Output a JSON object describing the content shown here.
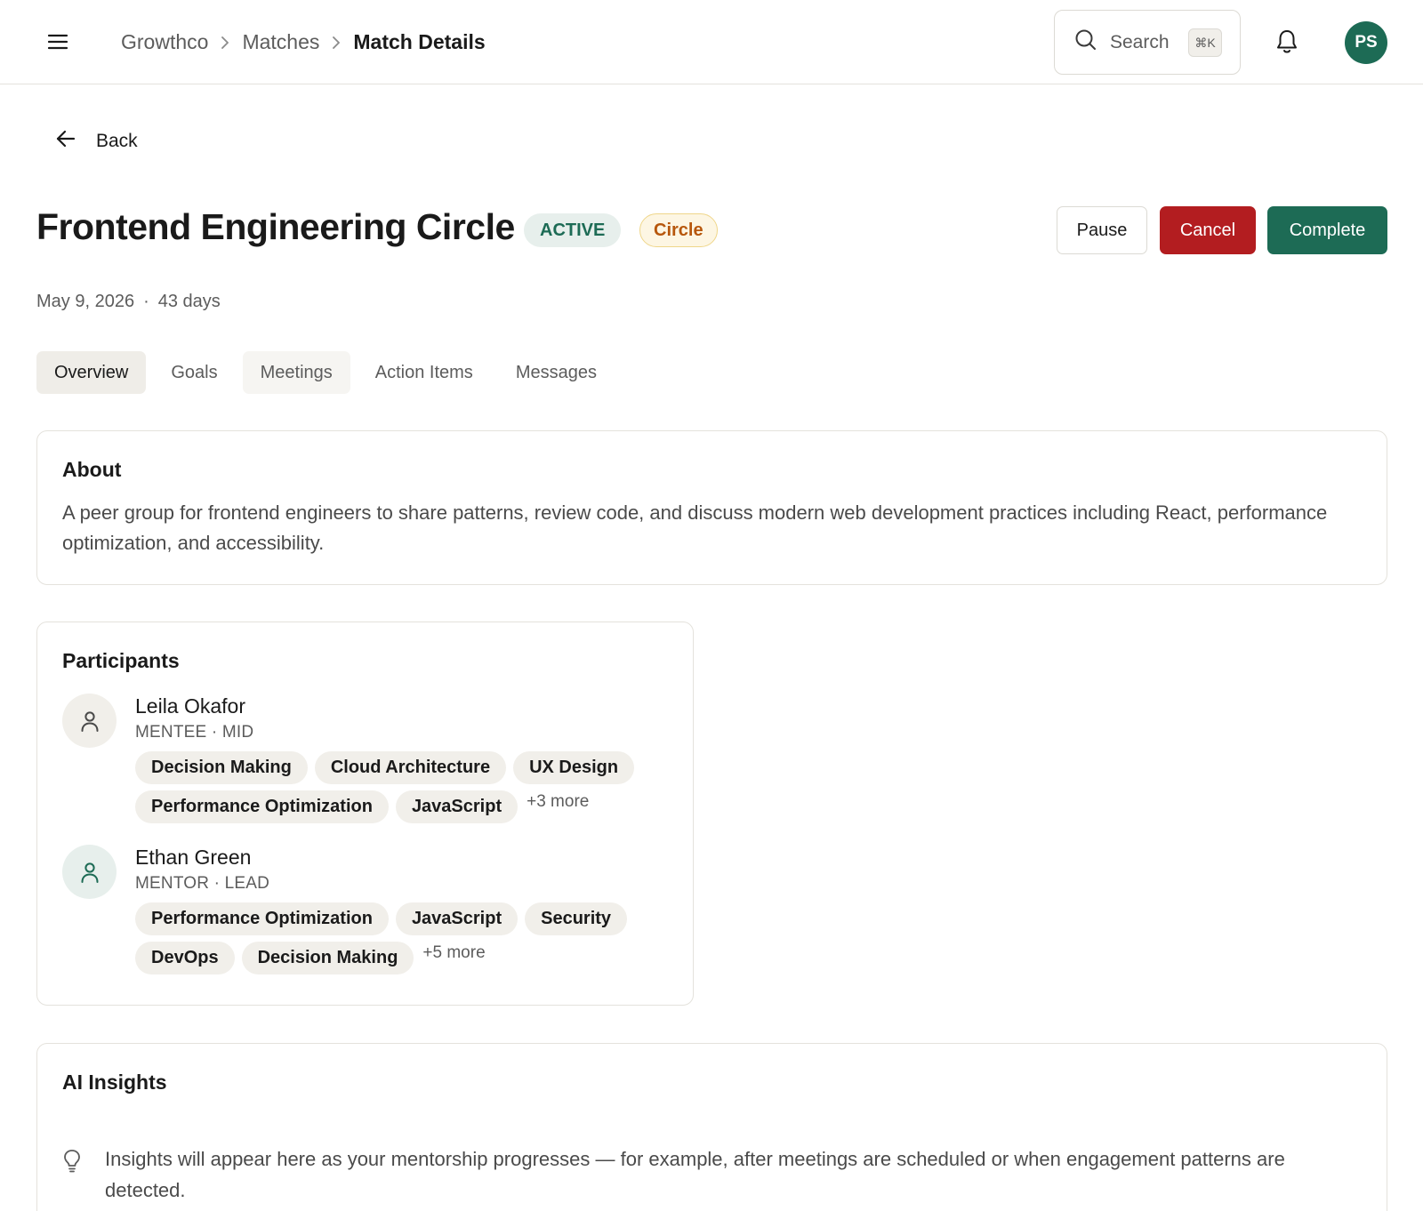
{
  "header": {
    "breadcrumb": [
      "Growthco",
      "Matches",
      "Match Details"
    ],
    "search_label": "Search",
    "search_shortcut": "⌘K",
    "user_initials": "PS"
  },
  "back_label": "Back",
  "match": {
    "title": "Frontend Engineering Circle",
    "status": "ACTIVE",
    "type": "Circle",
    "date": "May 9, 2026",
    "separator": "·",
    "duration": "43 days"
  },
  "actions": {
    "pause": "Pause",
    "cancel": "Cancel",
    "complete": "Complete"
  },
  "tabs": [
    "Overview",
    "Goals",
    "Meetings",
    "Action Items",
    "Messages"
  ],
  "about": {
    "title": "About",
    "text": "A peer group for frontend engineers to share patterns, review code, and discuss modern web development practices including React, performance optimization, and accessibility."
  },
  "participants": {
    "title": "Participants",
    "people": [
      {
        "name": "Leila Okafor",
        "role": "MENTEE · MID",
        "tags": [
          "Decision Making",
          "Cloud Architecture",
          "UX Design",
          "Performance Optimization",
          "JavaScript"
        ],
        "more": "+3 more"
      },
      {
        "name": "Ethan Green",
        "role": "MENTOR · LEAD",
        "tags": [
          "Performance Optimization",
          "JavaScript",
          "Security",
          "DevOps",
          "Decision Making"
        ],
        "more": "+5 more"
      }
    ]
  },
  "ai_insights": {
    "title": "AI Insights",
    "text": "Insights will appear here as your mentorship progresses — for example, after meetings are scheduled or when engagement patterns are detected."
  },
  "colors": {
    "brand_green": "#1d6b55",
    "danger_red": "#b31d20",
    "circle_badge_text": "#b7570c",
    "circle_badge_border": "#efd68a"
  },
  "icons": {
    "menu": "menu-icon",
    "breadcrumb_separator": "chevron-right-icon",
    "search": "search-icon",
    "notifications": "bell-icon",
    "back": "arrow-left-icon",
    "participant": "user-icon",
    "insight": "lightbulb-icon"
  }
}
